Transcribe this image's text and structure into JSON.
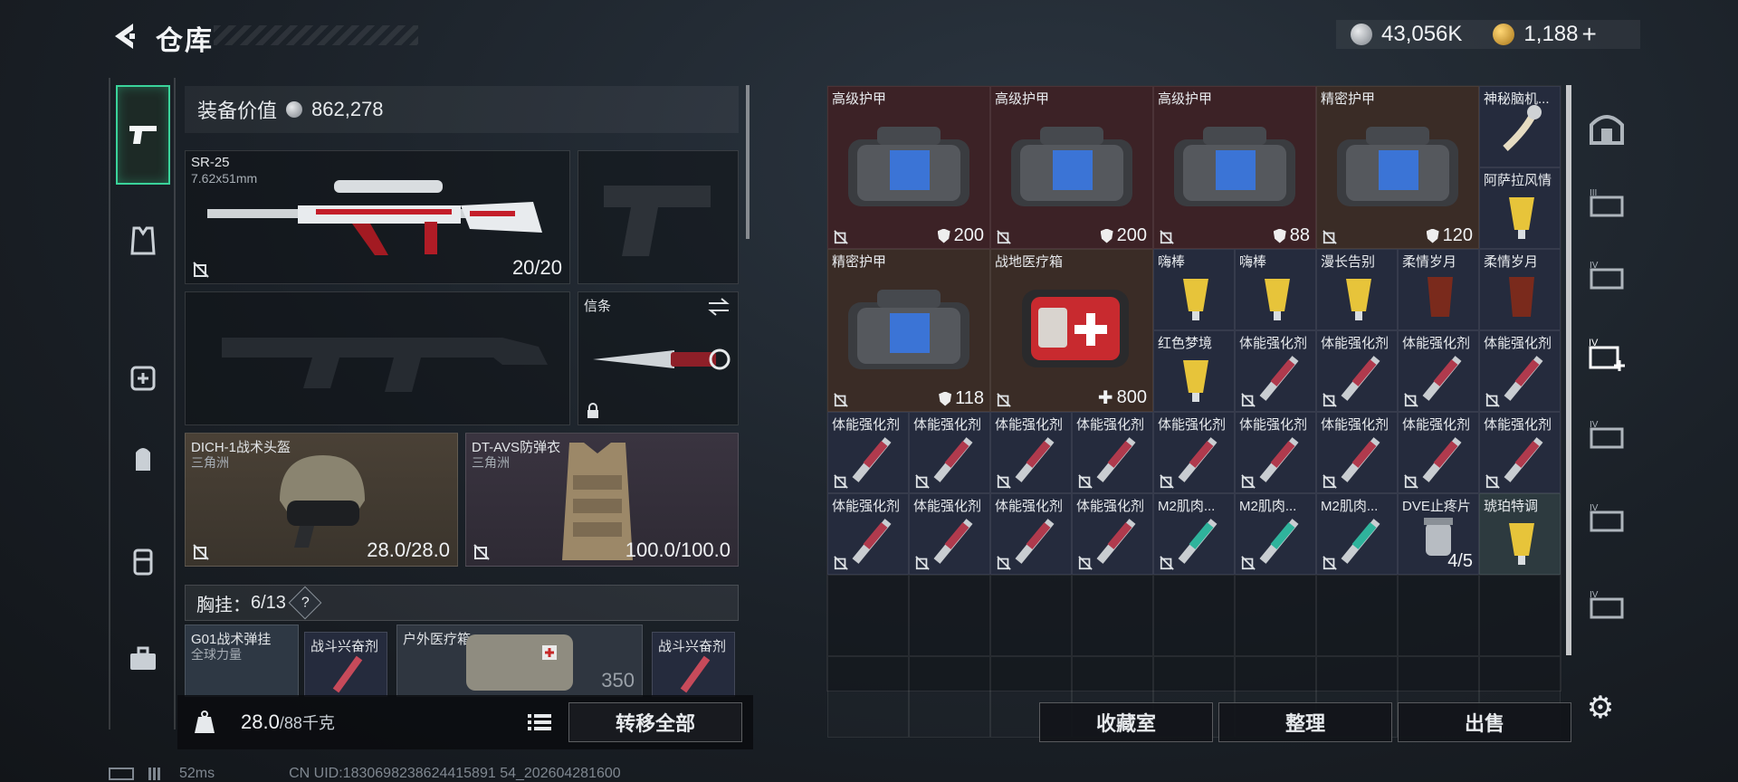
{
  "header": {
    "title": "仓库",
    "silver_balance": "43,056K",
    "gold_balance": "1,188",
    "gold_plus": "+"
  },
  "left_rail": [
    "gun-icon",
    "vest-icon",
    "medkit-icon",
    "backpack-icon",
    "chest-rig-icon",
    "toolbox-icon"
  ],
  "loadout": {
    "value_label": "装备价值",
    "value": "862,278",
    "primary": {
      "name": "SR-25",
      "caliber": "7.62x51mm",
      "ammo": "20/20"
    },
    "melee": {
      "name": "信条"
    },
    "helmet": {
      "name": "DICH-1战术头盔",
      "origin": "三角洲",
      "durability": "28.0/28.0"
    },
    "armor": {
      "name": "DT-AVS防弹衣",
      "origin": "三角洲",
      "durability": "100.0/100.0"
    },
    "chest": {
      "label": "胸挂：",
      "count": "6/13",
      "help": "?"
    },
    "chest_items": [
      {
        "name": "G01战术弹挂",
        "sub": "全球力量"
      },
      {
        "name": "战斗兴奋剂"
      },
      {
        "name": "户外医疗箱",
        "val": "350"
      },
      {
        "name": "战斗兴奋剂"
      }
    ]
  },
  "bottom_bar": {
    "weight": "28.0",
    "weight_max": "/88千克",
    "transfer_label": "转移全部"
  },
  "status": {
    "ping": "52ms",
    "uid": "CN UID:1830698238624415891 54_202604281600"
  },
  "stash": {
    "row1": [
      {
        "name": "高级护甲",
        "val": "200",
        "kind": "shield"
      },
      {
        "name": "高级护甲",
        "val": "200",
        "kind": "shield"
      },
      {
        "name": "高级护甲",
        "val": "88",
        "kind": "shield"
      },
      {
        "name": "精密护甲",
        "val": "120",
        "kind": "shield"
      },
      {
        "name": "神秘脑机..."
      },
      {
        "name": "阿萨拉风情"
      }
    ],
    "row2": [
      {
        "name": "精密护甲",
        "val": "118",
        "kind": "shield"
      },
      {
        "name": "战地医疗箱",
        "val": "800",
        "kind": "plus"
      },
      {
        "name": "嗨棒"
      },
      {
        "name": "嗨棒"
      },
      {
        "name": "漫长告别"
      },
      {
        "name": "柔情岁月"
      },
      {
        "name": "柔情岁月"
      }
    ],
    "row3": [
      {
        "name": "红色梦境"
      },
      {
        "name": "体能强化剂"
      },
      {
        "name": "体能强化剂"
      },
      {
        "name": "体能强化剂"
      },
      {
        "name": "体能强化剂"
      }
    ],
    "row4": [
      "体能强化剂",
      "体能强化剂",
      "体能强化剂",
      "体能强化剂",
      "体能强化剂",
      "体能强化剂",
      "体能强化剂",
      "体能强化剂",
      "体能强化剂"
    ],
    "row5": [
      {
        "name": "体能强化剂"
      },
      {
        "name": "体能强化剂"
      },
      {
        "name": "体能强化剂"
      },
      {
        "name": "体能强化剂"
      },
      {
        "name": "M2肌肉..."
      },
      {
        "name": "M2肌肉..."
      },
      {
        "name": "M2肌肉..."
      },
      {
        "name": "DVE止疼片",
        "val": "4/5"
      },
      {
        "name": "琥珀特调"
      }
    ]
  },
  "right_rail": [
    "vault-icon",
    "case-IV-icon",
    "case-IV-2-icon",
    "case-IV-add-icon",
    "case-IV-3-icon",
    "case-IV-4-icon",
    "case-IV-5-icon"
  ],
  "right_rail_labels": [
    "IV",
    "IV",
    "IV",
    "IV",
    "IV",
    "IV"
  ],
  "actions": {
    "collection": "收藏室",
    "sort": "整理",
    "sell": "出售"
  },
  "colors": {
    "accent_green": "#3ad39a",
    "armor_red": "#3c2226",
    "medkit_brown": "#3a2c26",
    "consumable_blue": "#252b3d"
  }
}
